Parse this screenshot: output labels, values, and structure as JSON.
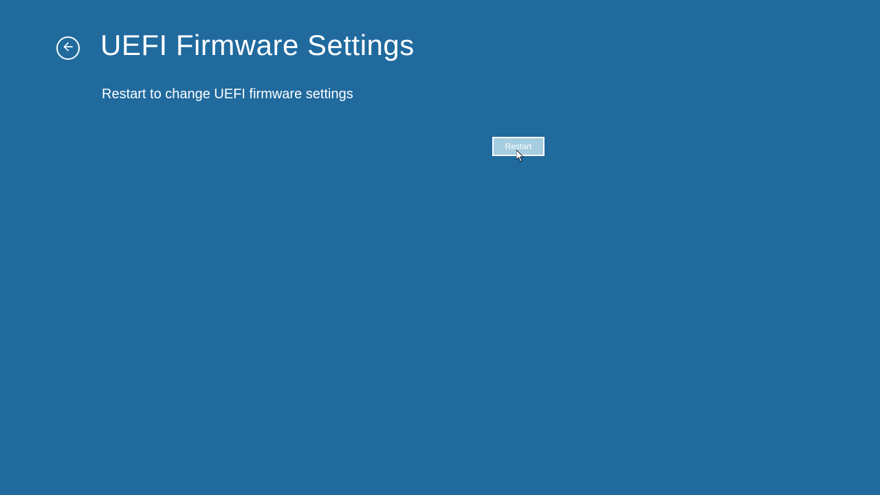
{
  "page": {
    "title": "UEFI Firmware Settings",
    "description": "Restart to change UEFI firmware settings"
  },
  "actions": {
    "restart_label": "Restart"
  }
}
